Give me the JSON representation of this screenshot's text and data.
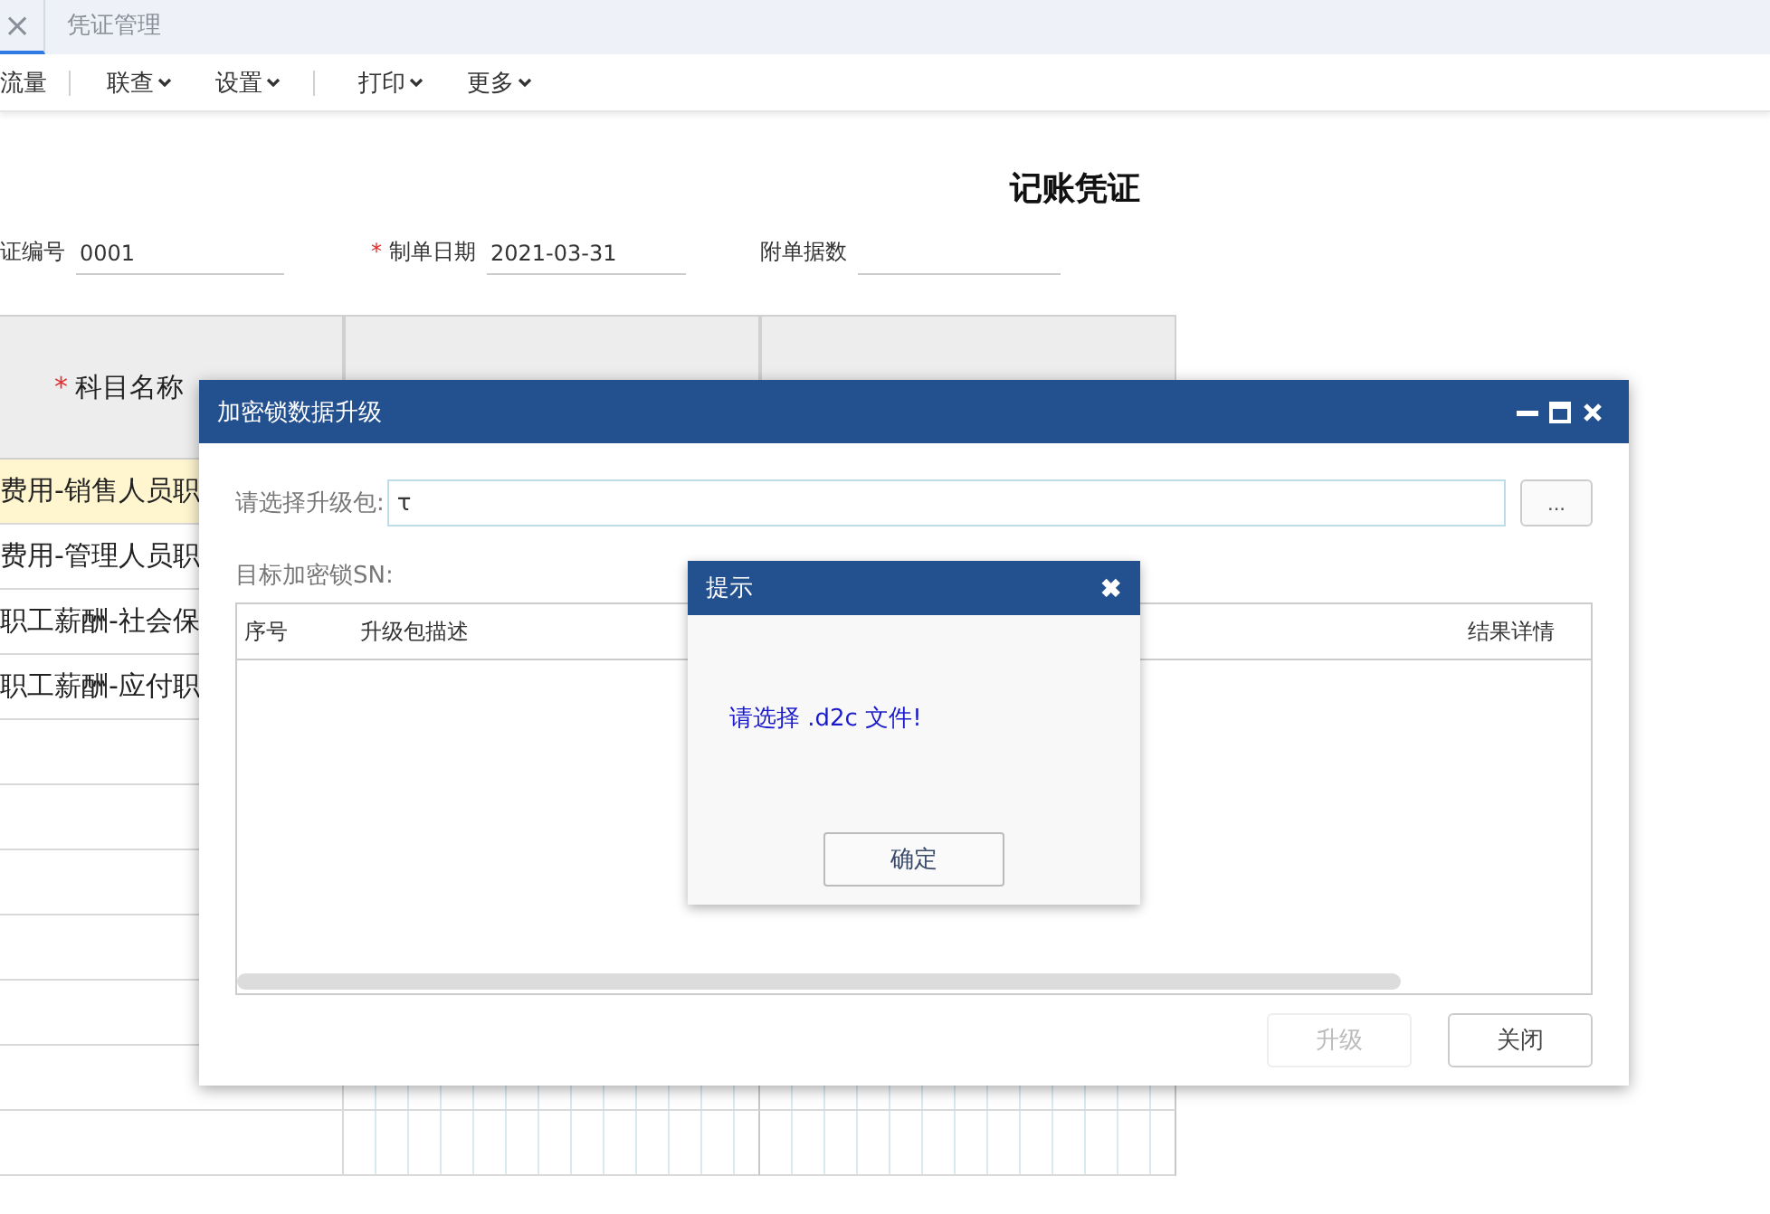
{
  "tabs": [
    {
      "close": "×",
      "selected": true
    },
    {
      "label": "凭证管理",
      "selected": false
    }
  ],
  "toolbar": [
    {
      "label": "流量",
      "dropdown": false,
      "separator_after": true
    },
    {
      "label": "联查",
      "dropdown": true,
      "separator_after": false
    },
    {
      "label": "设置",
      "dropdown": true,
      "separator_after": true
    },
    {
      "label": "打印",
      "dropdown": true,
      "separator_after": false
    },
    {
      "label": "更多",
      "dropdown": true,
      "separator_after": false
    }
  ],
  "voucher": {
    "title": "记账凭证",
    "fields": [
      {
        "label": "证编号",
        "value": "0001"
      },
      {
        "marker": "*",
        "label": "制单日期",
        "value": "2021-03-31"
      },
      {
        "label": "附单据数"
      }
    ]
  },
  "ledger": {
    "subject_header": {
      "marker": "*",
      "label": "科目名称"
    },
    "rows": [
      {
        "subject": "费用-销售人员职",
        "selected": true
      },
      {
        "subject": "费用-管理人员职",
        "selected": false
      },
      {
        "subject": "职工薪酬-社会保",
        "selected": false
      },
      {
        "subject": "职工薪酬-应付职",
        "selected": false
      }
    ]
  },
  "upgrade_dialog": {
    "title": "加密锁数据升级",
    "file_label": "请选择升级包:",
    "file_value": "τ",
    "browse": "...",
    "sn_label": "目标加密锁SN:",
    "columns": [
      "序号",
      "升级包描述",
      "结果详情"
    ],
    "buttons": [
      {
        "label": "升级",
        "disabled": true
      },
      {
        "label": "关闭",
        "disabled": false
      }
    ]
  },
  "alert": {
    "title": "提示",
    "close": "✖",
    "message": "请选择 .d2c 文件!",
    "button": "确定"
  }
}
